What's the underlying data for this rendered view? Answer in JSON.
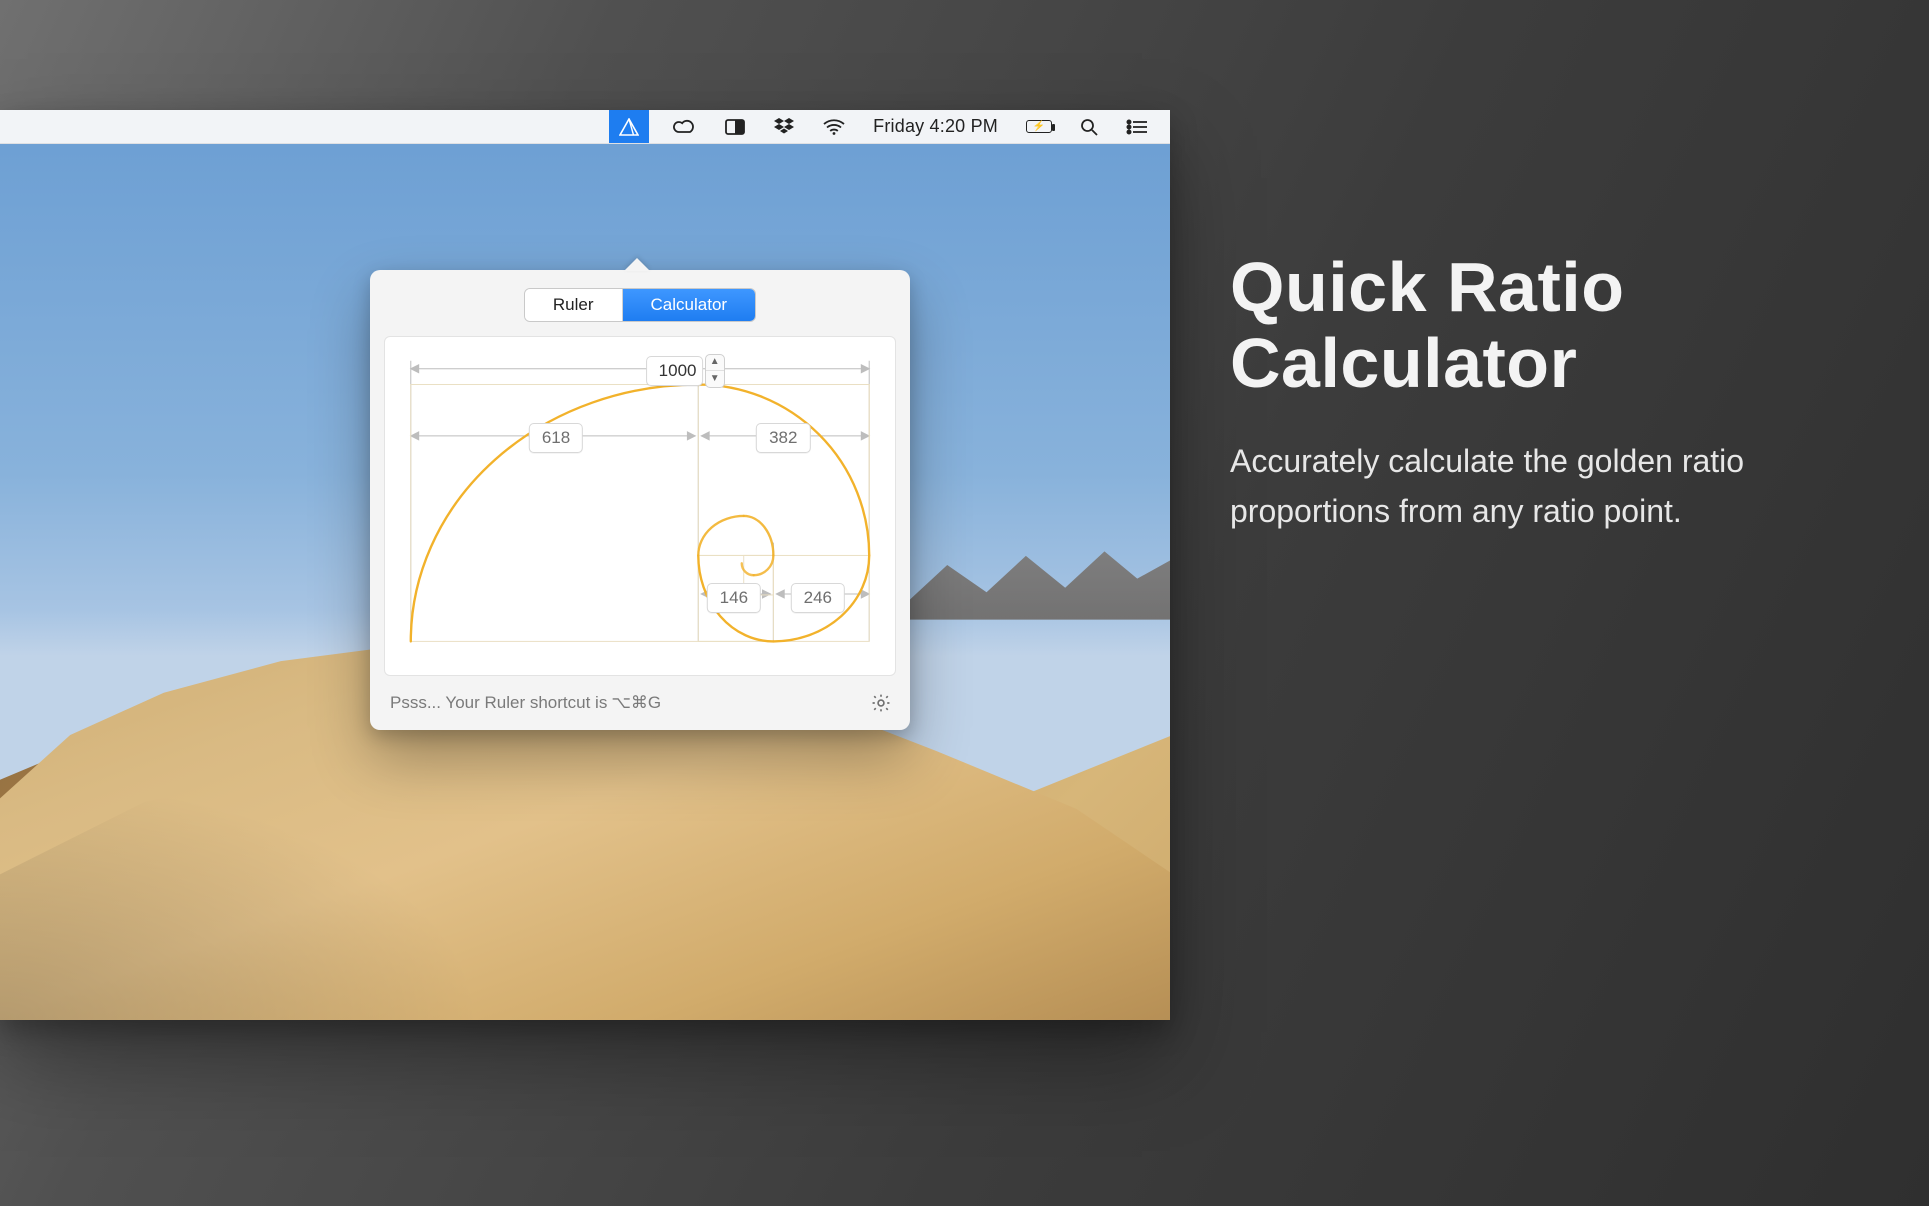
{
  "menubar": {
    "appIcon": "goldie-icon",
    "items": [
      "creative-cloud-icon",
      "panel-icon",
      "dropbox-icon",
      "wifi-icon"
    ],
    "clock": "Friday 4:20 PM",
    "battery": {
      "charging": true
    },
    "rightItems": [
      "spotlight-icon",
      "control-center-icon"
    ]
  },
  "popover": {
    "tabs": {
      "ruler": "Ruler",
      "calculator": "Calculator",
      "active": "calculator"
    },
    "values": {
      "total": "1000",
      "left": "618",
      "right": "382",
      "subLeft": "146",
      "subRight": "246"
    },
    "footer": {
      "hint_prefix": "Psss... Your Ruler shortcut is ",
      "shortcut": "⌥⌘G"
    }
  },
  "promo": {
    "title_l1": "Quick Ratio",
    "title_l2": "Calculator",
    "body": "Accurately calculate the golden ratio proportions from any ratio point."
  },
  "colors": {
    "accent": "#1e7df0",
    "spiral": "#f2b22b",
    "guide": "#b9b9b9"
  }
}
